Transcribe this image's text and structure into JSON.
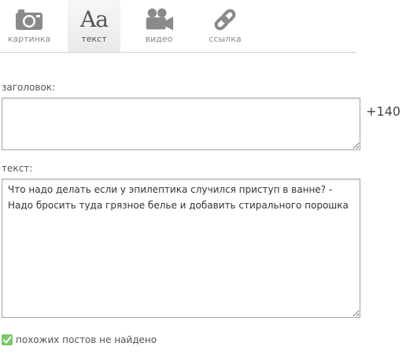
{
  "tabs": [
    {
      "label": "картинка",
      "icon": "camera-icon"
    },
    {
      "label": "текст",
      "icon": "text-aa-icon",
      "glyph": "Aa",
      "active": true
    },
    {
      "label": "видео",
      "icon": "video-camera-icon"
    },
    {
      "label": "ссылка",
      "icon": "link-chain-icon"
    }
  ],
  "form": {
    "title_label": "заголовок:",
    "title_value": "",
    "counter": "+140",
    "text_label": "текст:",
    "text_value": "Что надо делать если у эпилептика случился приступ в ванне? - Надо бросить туда грязное белье и добавить стирального порошка"
  },
  "status": {
    "text": "похожих постов не найдено",
    "icon": "checkmark-icon",
    "color": "#7cc56a"
  },
  "colors": {
    "icon_gray": "#8a8a8a",
    "active_tab_bg": "#ececec",
    "border": "#aaaaaa"
  }
}
